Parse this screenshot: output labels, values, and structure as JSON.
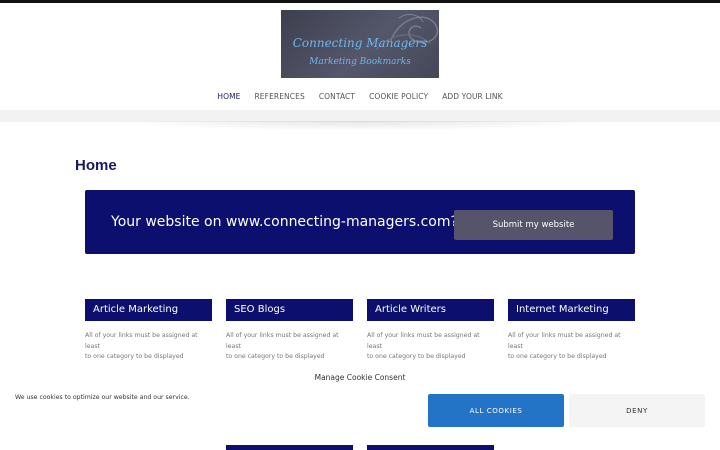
{
  "logo": {
    "line1": "Connecting Managers",
    "line2": "Marketing Bookmarks"
  },
  "nav": [
    {
      "label": "HOME"
    },
    {
      "label": "REFERENCES"
    },
    {
      "label": "CONTACT"
    },
    {
      "label": "COOKIE POLICY"
    },
    {
      "label": "ADD YOUR LINK"
    }
  ],
  "page_title": "Home",
  "hero": {
    "text": "Your website on www.connecting-managers.com?",
    "button": "Submit my website"
  },
  "cards": [
    {
      "title": "Article Marketing",
      "line1": "All of your links must be assigned at least",
      "line2": "to one category to be displayed"
    },
    {
      "title": "SEO Blogs",
      "line1": "All of your links must be assigned at least",
      "line2": "to one category to be displayed"
    },
    {
      "title": "Article Writers",
      "line1": "All of your links must be assigned at least",
      "line2": "to one category to be displayed"
    },
    {
      "title": "Internet Marketing",
      "line1": "All of your links must be assigned at least",
      "line2": "to one category to be displayed"
    }
  ],
  "cookie": {
    "title": "Manage Cookie Consent",
    "message": "We use cookies to optimize our website and our service.",
    "accept": "ALL COOKIES",
    "deny": "DENY"
  },
  "colors": {
    "primary": "#0c0f6e",
    "accent": "#2374c6",
    "button_muted": "#55546a"
  }
}
